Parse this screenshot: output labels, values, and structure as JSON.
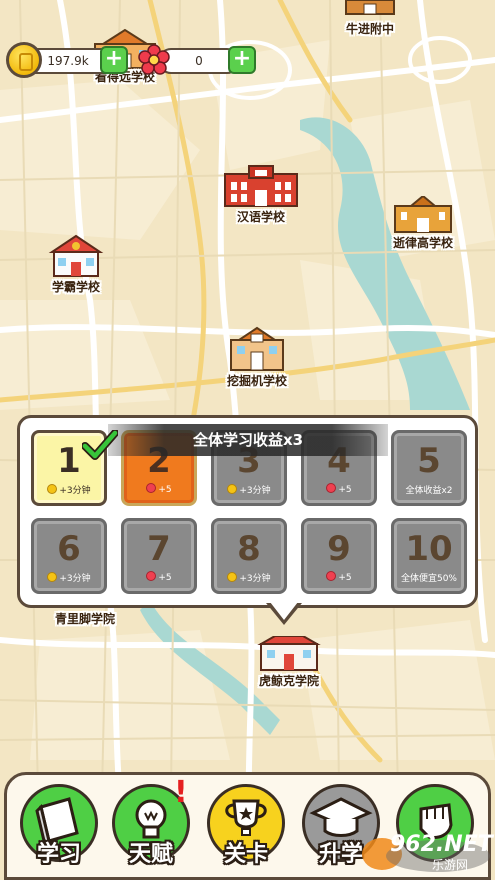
{
  "currencies": {
    "coins": "197.9k",
    "flowers": "0"
  },
  "schools": [
    {
      "label": "牛进附中"
    },
    {
      "label": "看得远学校"
    },
    {
      "label": "汉语学校"
    },
    {
      "label": "逝律高学校"
    },
    {
      "label": "学霸学校"
    },
    {
      "label": "挖掘机学校"
    },
    {
      "label": "青里脚学院"
    },
    {
      "label": "虎鲸克学院"
    }
  ],
  "level_panel": {
    "banner": "全体学习收益x3",
    "tiles": [
      {
        "num": "1",
        "reward": "+3分钟",
        "reward_icon": "coin",
        "state": "current"
      },
      {
        "num": "2",
        "reward": "+5",
        "reward_icon": "flower",
        "state": "next"
      },
      {
        "num": "3",
        "reward": "+3分钟",
        "reward_icon": "coin",
        "state": "locked"
      },
      {
        "num": "4",
        "reward": "+5",
        "reward_icon": "flower",
        "state": "locked"
      },
      {
        "num": "5",
        "reward": "全体收益x2",
        "reward_icon": "",
        "state": "locked"
      },
      {
        "num": "6",
        "reward": "+3分钟",
        "reward_icon": "coin",
        "state": "locked"
      },
      {
        "num": "7",
        "reward": "+5",
        "reward_icon": "flower",
        "state": "locked"
      },
      {
        "num": "8",
        "reward": "+3分钟",
        "reward_icon": "coin",
        "state": "locked"
      },
      {
        "num": "9",
        "reward": "+5",
        "reward_icon": "flower",
        "state": "locked"
      },
      {
        "num": "10",
        "reward": "全体便宜50%",
        "reward_icon": "",
        "state": "locked"
      }
    ]
  },
  "nav": [
    {
      "label": "学习",
      "icon": "book-icon",
      "color": "#4fcf45"
    },
    {
      "label": "天赋",
      "icon": "lightbulb-icon",
      "color": "#4fcf45"
    },
    {
      "label": "关卡",
      "icon": "trophy-icon",
      "color": "#f7d21e"
    },
    {
      "label": "升学",
      "icon": "graduation-cap-icon",
      "color": "#9a9a9a"
    },
    {
      "label": "",
      "icon": "fist-icon",
      "color": "#4fcf45"
    }
  ],
  "alert_mark": "!",
  "watermark": {
    "brand": "962.NET",
    "sub": "乐游网"
  }
}
